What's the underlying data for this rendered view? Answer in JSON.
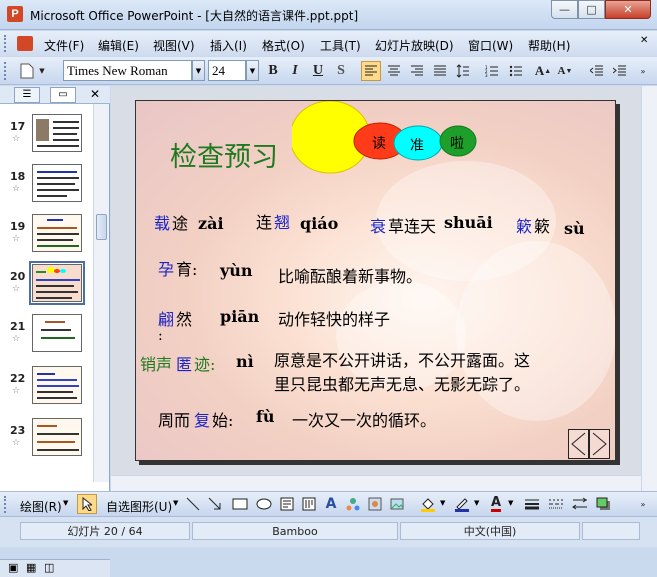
{
  "window": {
    "title": "Microsoft Office PowerPoint - [大自然的语言课件.ppt.ppt]"
  },
  "menu": [
    "文件(F)",
    "编辑(E)",
    "视图(V)",
    "插入(I)",
    "格式(O)",
    "工具(T)",
    "幻灯片放映(D)",
    "窗口(W)",
    "帮助(H)"
  ],
  "toolbar": {
    "font_name": "Times New Roman",
    "font_size": "24",
    "bold": "B",
    "italic": "I",
    "underline": "U",
    "shadow": "S"
  },
  "thumbnails": [
    "17",
    "18",
    "19",
    "20",
    "21",
    "22",
    "23"
  ],
  "slide": {
    "title": "检查预习",
    "circles": [
      "读",
      "准",
      "啦"
    ],
    "words": [
      {
        "hanzi_hl": "载",
        "hanzi": "途",
        "pinyin": "zài"
      },
      {
        "hanzi": "连",
        "hanzi_hl": "翘",
        "pinyin": "qiáo"
      },
      {
        "hanzi_hl": "衰",
        "hanzi": "草连天",
        "pinyin": "shuāi"
      },
      {
        "hanzi_hl": "簌",
        "hanzi": "簌",
        "pinyin": "sù"
      }
    ],
    "yun": {
      "hl": "孕",
      "rest": "育:",
      "pinyin": "yùn",
      "meaning": "比喻酝酿着新事物。"
    },
    "pian": {
      "hl": "翩",
      "rest": "然",
      "colon": ":",
      "pinyin": "piān",
      "meaning": "动作轻快的样子"
    },
    "ni": {
      "a": "销声",
      "hl": "匿",
      "b": "迹:",
      "pinyin": "nì",
      "meaning1": "原意是不公开讲话，不公开露面。这",
      "meaning2": "里只昆虫都无声无息、无影无踪了。"
    },
    "fu": {
      "a": "周而",
      "hl": "复",
      "b": "始:",
      "pinyin": "fù",
      "meaning": "一次又一次的循环。"
    }
  },
  "drawbar": {
    "draw": "绘图(R)",
    "autoshapes": "自选图形(U)"
  },
  "status": {
    "slide_info": "幻灯片 20 / 64",
    "design": "Bamboo",
    "language": "中文(中国)"
  },
  "colors": {
    "title_green": "#1f7a1f",
    "highlight_blue": "#1a23c8",
    "circle_yellow": "#ffff00",
    "circle_red": "#ff3b1a",
    "circle_cyan": "#00ffff",
    "circle_green": "#1e9f2a"
  }
}
